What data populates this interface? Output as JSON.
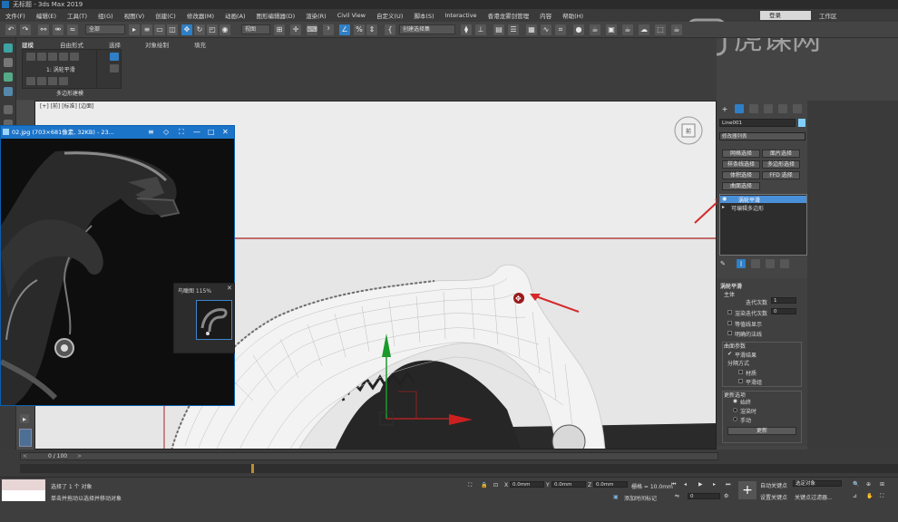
{
  "window": {
    "title": "无标题 - 3ds Max 2019"
  },
  "menu": {
    "items": [
      "文件(F)",
      "编辑(E)",
      "工具(T)",
      "组(G)",
      "视图(V)",
      "创建(C)",
      "修改器(M)",
      "动画(A)",
      "图形编辑器(D)",
      "渲染(R)",
      "Civil View",
      "自定义(U)",
      "脚本(S)",
      "Interactive",
      "香港龙雾剑管理",
      "内容",
      "帮助(H)"
    ],
    "login": "登录",
    "workspace": "工作区"
  },
  "toolbar": {
    "filter_dropdown": "全部",
    "view_dropdown": "视图",
    "selection_set": "创建选择集"
  },
  "ribbon": {
    "tabs": [
      "建模",
      "自由形式",
      "选择",
      "对象绘制",
      "填充"
    ],
    "turbosmooth_label": "1: 涡轮平滑",
    "poly_modeling": "多边形建模"
  },
  "viewport": {
    "label": "[+] [前] [标准] [边面]"
  },
  "image_viewer": {
    "title": "02.jpg (703×681像素, 32KB) - 23...",
    "navigator_title": "鸟瞰图 115%"
  },
  "command_panel": {
    "object_name": "Line001",
    "color": "#7fd0ff",
    "modifier_list": "修改器列表",
    "selection_buttons": [
      "网格选择",
      "面片选择",
      "样条线选择",
      "多边形选择",
      "体积选择",
      "FFD 选择",
      "曲面选择"
    ],
    "stack": [
      "涡轮平滑",
      "可编辑多边形"
    ],
    "rollout_title": "涡轮平滑",
    "main_label": "主体",
    "iterations_label": "迭代次数",
    "iterations_value": "1",
    "render_iters_label": "渲染迭代次数",
    "render_iters_value": "0",
    "isoline_label": "等值线显示",
    "explicit_normals_label": "明确的法线",
    "surface_params_label": "曲面参数",
    "smooth_result_label": "平滑结果",
    "separate_label": "分隔方式",
    "materials_label": "材质",
    "smoothing_groups_label": "平滑组",
    "update_options_label": "更新选项",
    "always_label": "始终",
    "when_rendering_label": "渲染时",
    "manually_label": "手动",
    "update_button": "更新"
  },
  "timeline": {
    "frame": "0 / 100"
  },
  "status": {
    "selected": "选择了 1 个 对象",
    "hint": "单击并拖动以选择并移动对象",
    "x": "0.0mm",
    "y": "0.0mm",
    "z": "0.0mm",
    "grid": "栅格 = 10.0mm",
    "add_time_tag": "添加时间标记",
    "auto_key": "自动关键点",
    "set_key": "设置关键点",
    "selected_obj": "选定对象",
    "key_filters": "关键点过滤器...",
    "frame_value": "0"
  },
  "watermark": {
    "text": "虎课网"
  }
}
